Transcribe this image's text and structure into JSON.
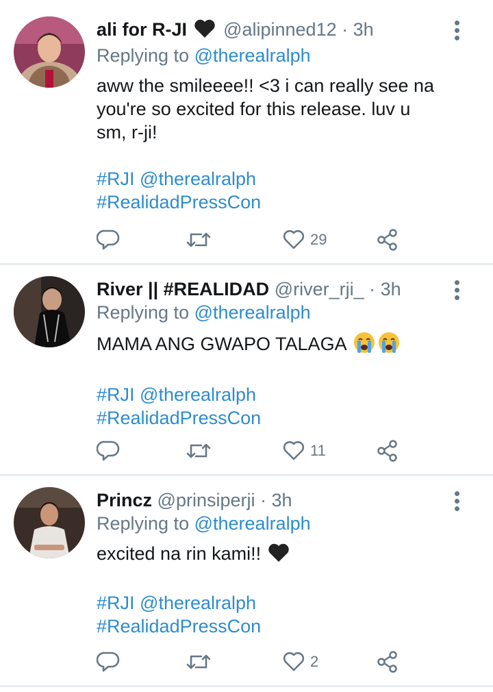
{
  "colors": {
    "link": "#2c8ccf",
    "text": "#14171a",
    "secondary": "#657786",
    "divider": "#e6ecf0"
  },
  "tweets": [
    {
      "display_name": "ali for R-JI",
      "handle": "@alipinned12",
      "time": "· 3h",
      "replying_prefix": "Replying to",
      "replying_to": "@therealralph",
      "body": "aww the smileeee!! <3 i can really see na you're so excited for this release. luv u sm, r-ji!",
      "hashtag_line1_tag": "#RJI",
      "hashtag_line1_mention": "@therealralph",
      "hashtag_line2": "#RealidadPressCon",
      "likes": "29",
      "icons": [
        "black-heart-icon",
        "reply-icon",
        "retweet-icon",
        "like-icon",
        "share-icon",
        "more-icon"
      ]
    },
    {
      "display_name": "River || #REALIDAD",
      "handle": "@river_rji_",
      "time": "· 3h",
      "replying_prefix": "Replying to",
      "replying_to": "@therealralph",
      "body": "MAMA ANG GWAPO TALAGA",
      "hashtag_line1_tag": "#RJI",
      "hashtag_line1_mention": "@therealralph",
      "hashtag_line2": "#RealidadPressCon",
      "likes": "11",
      "icons": [
        "crying-emoji-icon",
        "reply-icon",
        "retweet-icon",
        "like-icon",
        "share-icon",
        "more-icon"
      ]
    },
    {
      "display_name": "Princz",
      "handle": "@prinsiperji",
      "time": "· 3h",
      "replying_prefix": "Replying to",
      "replying_to": "@therealralph",
      "body": "excited na rin kami!!",
      "hashtag_line1_tag": "#RJI",
      "hashtag_line1_mention": "@therealralph",
      "hashtag_line2": "#RealidadPressCon",
      "likes": "2",
      "icons": [
        "black-heart-icon",
        "reply-icon",
        "retweet-icon",
        "like-icon",
        "share-icon",
        "more-icon"
      ]
    }
  ]
}
